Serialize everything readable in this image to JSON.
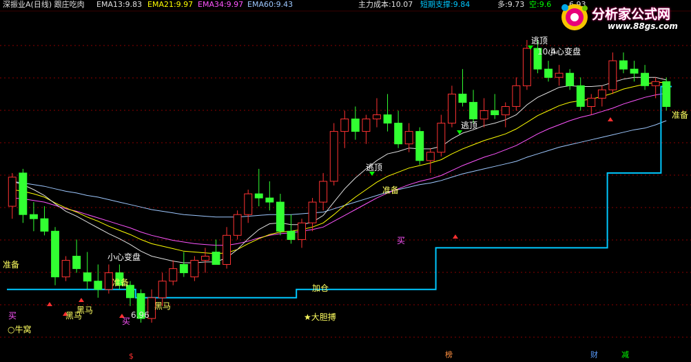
{
  "header": {
    "symbol": "深振业A",
    "period": "(日线)",
    "indicator": "跟庄吃肉",
    "ema13": {
      "label": "EMA13:",
      "value": "9.83",
      "color": "#e0e0e0"
    },
    "ema21": {
      "label": "EMA21:",
      "value": "9.97",
      "color": "#ffff00"
    },
    "ema34": {
      "label": "EMA34:",
      "value": "9.97",
      "color": "#ff55ff"
    },
    "ema60": {
      "label": "EMA60:",
      "value": "9.43",
      "color": "#9ec8ff"
    },
    "main_cost": {
      "label": "主力成本:",
      "value": "10.07",
      "color": "#e0e0e0"
    },
    "support": {
      "label": "短期支撑:",
      "value": "9.84",
      "color": "#00c8ff"
    },
    "long": {
      "label": "多:",
      "value": "9.73",
      "color": "#e0e0e0"
    },
    "short": {
      "label": "空:",
      "value": "9.6",
      "color": "#00ff00"
    },
    "trail": "6.93"
  },
  "logo": {
    "name": "分析家公式网",
    "url": "www.88gs.com"
  },
  "annotations": [
    {
      "text": "准备",
      "color": "#ffff60"
    },
    {
      "text": "买",
      "color": "#ff55ff"
    },
    {
      "text": "○牛窝",
      "color": "#ffff60"
    },
    {
      "text": "黑马",
      "color": "#ffff60"
    },
    {
      "text": "黑马",
      "color": "#ffff60"
    },
    {
      "text": "准备",
      "color": "#ffff60"
    },
    {
      "text": "小心变盘",
      "color": "#ffffff"
    },
    {
      "text": "买",
      "color": "#ff55ff"
    },
    {
      "text": "6.96",
      "color": "#e0e0e0"
    },
    {
      "text": "黑马",
      "color": "#ffff60"
    },
    {
      "text": "加仓",
      "color": "#ffff60"
    },
    {
      "text": "★大胆搏",
      "color": "#ffff60"
    },
    {
      "text": "逃顶",
      "color": "#ffffff"
    },
    {
      "text": "准备",
      "color": "#ffff60"
    },
    {
      "text": "买",
      "color": "#ff55ff"
    },
    {
      "text": "逃顶",
      "color": "#ffffff"
    },
    {
      "text": "逃顶",
      "color": "#ffffff"
    },
    {
      "text": "10.4",
      "color": "#e0e0e0"
    },
    {
      "text": "小心变盘",
      "color": "#ffffff"
    },
    {
      "text": "准备",
      "color": "#ffff60"
    }
  ],
  "markers": [
    {
      "text": "$",
      "color": "#ff3030"
    },
    {
      "text": "榜",
      "color": "#ff9040"
    },
    {
      "text": "财",
      "color": "#5a9cff"
    },
    {
      "text": "减",
      "color": "#00ff00"
    }
  ],
  "colors": {
    "up": "#ff3232",
    "down": "#32ff32",
    "ema13": "#e0e0e0",
    "ema21": "#ffff00",
    "ema34": "#ff55ff",
    "ema60": "#9ec8ff",
    "support": "#00c8ff",
    "grid": "#8b0000"
  },
  "chart_data": {
    "type": "candlestick",
    "y_range": [
      6.9,
      10.4
    ],
    "candles": [
      [
        8.4,
        8.8,
        8.25,
        8.75
      ],
      [
        8.8,
        8.85,
        8.2,
        8.3
      ],
      [
        8.3,
        8.45,
        8.1,
        8.25
      ],
      [
        8.25,
        8.4,
        8.05,
        8.1
      ],
      [
        8.1,
        8.15,
        7.45,
        7.55
      ],
      [
        7.55,
        7.8,
        7.5,
        7.75
      ],
      [
        7.8,
        8.0,
        7.6,
        7.65
      ],
      [
        7.6,
        7.85,
        7.4,
        7.5
      ],
      [
        7.5,
        7.7,
        7.3,
        7.4
      ],
      [
        7.4,
        7.7,
        7.35,
        7.6
      ],
      [
        7.6,
        7.7,
        7.4,
        7.45
      ],
      [
        7.45,
        7.5,
        7.2,
        7.3
      ],
      [
        7.35,
        7.4,
        7.0,
        7.05
      ],
      [
        7.05,
        7.4,
        7.0,
        7.3
      ],
      [
        7.3,
        7.6,
        7.2,
        7.5
      ],
      [
        7.5,
        7.75,
        7.45,
        7.65
      ],
      [
        7.7,
        7.85,
        7.55,
        7.6
      ],
      [
        7.55,
        7.8,
        7.5,
        7.75
      ],
      [
        7.75,
        7.9,
        7.6,
        7.8
      ],
      [
        7.85,
        8.0,
        7.7,
        7.7
      ],
      [
        7.7,
        8.15,
        7.65,
        8.05
      ],
      [
        8.05,
        8.35,
        8.0,
        8.3
      ],
      [
        8.3,
        8.6,
        8.2,
        8.55
      ],
      [
        8.55,
        8.85,
        8.4,
        8.5
      ],
      [
        8.5,
        8.7,
        8.35,
        8.45
      ],
      [
        8.45,
        8.55,
        8.05,
        8.1
      ],
      [
        8.1,
        8.3,
        7.95,
        8.0
      ],
      [
        8.0,
        8.25,
        7.9,
        8.2
      ],
      [
        8.2,
        8.5,
        8.1,
        8.45
      ],
      [
        8.45,
        8.8,
        8.35,
        8.7
      ],
      [
        8.7,
        9.4,
        8.65,
        9.3
      ],
      [
        9.3,
        9.55,
        9.1,
        9.45
      ],
      [
        9.45,
        9.6,
        9.2,
        9.3
      ],
      [
        9.3,
        9.5,
        9.15,
        9.45
      ],
      [
        9.45,
        9.7,
        9.35,
        9.5
      ],
      [
        9.5,
        9.75,
        9.3,
        9.4
      ],
      [
        9.4,
        9.55,
        9.1,
        9.15
      ],
      [
        9.15,
        9.4,
        9.05,
        9.3
      ],
      [
        9.3,
        9.35,
        8.9,
        8.95
      ],
      [
        8.95,
        9.1,
        8.8,
        9.05
      ],
      [
        9.05,
        9.5,
        9.0,
        9.4
      ],
      [
        9.4,
        9.85,
        9.35,
        9.75
      ],
      [
        9.75,
        10.05,
        9.6,
        9.65
      ],
      [
        9.65,
        9.8,
        9.4,
        9.45
      ],
      [
        9.45,
        9.7,
        9.35,
        9.55
      ],
      [
        9.55,
        9.75,
        9.45,
        9.5
      ],
      [
        9.5,
        9.65,
        9.35,
        9.6
      ],
      [
        9.6,
        9.95,
        9.55,
        9.85
      ],
      [
        9.85,
        10.4,
        9.8,
        10.3
      ],
      [
        10.3,
        10.4,
        10.0,
        10.05
      ],
      [
        10.05,
        10.15,
        9.9,
        9.95
      ],
      [
        9.95,
        10.1,
        9.85,
        10.0
      ],
      [
        10.0,
        10.05,
        9.8,
        9.85
      ],
      [
        9.85,
        9.95,
        9.55,
        9.6
      ],
      [
        9.6,
        9.75,
        9.5,
        9.7
      ],
      [
        9.7,
        9.85,
        9.6,
        9.8
      ],
      [
        9.8,
        10.25,
        9.75,
        10.15
      ],
      [
        10.15,
        10.25,
        10.0,
        10.05
      ],
      [
        10.05,
        10.15,
        9.9,
        10.0
      ],
      [
        10.0,
        10.1,
        9.8,
        9.85
      ],
      [
        9.85,
        9.95,
        9.7,
        9.9
      ],
      [
        9.9,
        9.95,
        9.55,
        9.6
      ]
    ],
    "ema13": [
      8.7,
      8.66,
      8.6,
      8.53,
      8.43,
      8.34,
      8.28,
      8.21,
      8.14,
      8.07,
      8.01,
      7.94,
      7.86,
      7.8,
      7.77,
      7.74,
      7.72,
      7.72,
      7.73,
      7.73,
      7.78,
      7.88,
      8.01,
      8.12,
      8.19,
      8.2,
      8.18,
      8.18,
      8.21,
      8.29,
      8.45,
      8.61,
      8.74,
      8.85,
      8.95,
      9.03,
      9.06,
      9.1,
      9.09,
      9.09,
      9.12,
      9.21,
      9.28,
      9.32,
      9.37,
      9.4,
      9.44,
      9.5,
      9.62,
      9.71,
      9.77,
      9.83,
      9.85,
      9.84,
      9.84,
      9.85,
      9.89,
      9.93,
      9.95,
      9.95,
      9.95,
      9.92
    ],
    "ema21": [
      8.6,
      8.58,
      8.55,
      8.51,
      8.44,
      8.38,
      8.33,
      8.27,
      8.22,
      8.16,
      8.11,
      8.06,
      8.0,
      7.95,
      7.92,
      7.89,
      7.86,
      7.85,
      7.84,
      7.83,
      7.84,
      7.88,
      7.95,
      8.01,
      8.06,
      8.09,
      8.1,
      8.12,
      8.15,
      8.2,
      8.3,
      8.41,
      8.51,
      8.6,
      8.69,
      8.76,
      8.81,
      8.86,
      8.89,
      8.92,
      8.96,
      9.03,
      9.09,
      9.14,
      9.19,
      9.23,
      9.27,
      9.33,
      9.41,
      9.49,
      9.55,
      9.61,
      9.65,
      9.67,
      9.69,
      9.72,
      9.76,
      9.81,
      9.84,
      9.87,
      9.89,
      9.89
    ],
    "ema34": [
      8.5,
      8.49,
      8.47,
      8.45,
      8.41,
      8.37,
      8.34,
      8.3,
      8.26,
      8.22,
      8.18,
      8.14,
      8.09,
      8.05,
      8.02,
      7.99,
      7.97,
      7.95,
      7.94,
      7.93,
      7.93,
      7.95,
      7.98,
      8.02,
      8.05,
      8.07,
      8.08,
      8.1,
      8.12,
      8.15,
      8.22,
      8.29,
      8.36,
      8.43,
      8.5,
      8.56,
      8.61,
      8.66,
      8.7,
      8.73,
      8.77,
      8.83,
      8.89,
      8.94,
      8.99,
      9.03,
      9.08,
      9.13,
      9.2,
      9.27,
      9.33,
      9.38,
      9.43,
      9.47,
      9.5,
      9.54,
      9.58,
      9.63,
      9.67,
      9.71,
      9.74,
      9.76
    ],
    "ema60": [
      8.7,
      8.68,
      8.66,
      8.64,
      8.61,
      8.58,
      8.56,
      8.53,
      8.51,
      8.48,
      8.45,
      8.42,
      8.39,
      8.36,
      8.34,
      8.32,
      8.3,
      8.29,
      8.28,
      8.27,
      8.27,
      8.27,
      8.28,
      8.29,
      8.3,
      8.3,
      8.3,
      8.31,
      8.32,
      8.33,
      8.37,
      8.41,
      8.45,
      8.49,
      8.53,
      8.57,
      8.6,
      8.63,
      8.66,
      8.68,
      8.71,
      8.75,
      8.79,
      8.82,
      8.85,
      8.88,
      8.91,
      8.94,
      8.99,
      9.03,
      9.07,
      9.11,
      9.14,
      9.17,
      9.2,
      9.23,
      9.26,
      9.29,
      9.32,
      9.34,
      9.38,
      9.43
    ],
    "support": [
      7.4,
      7.4,
      7.4,
      7.4,
      7.4,
      7.4,
      7.4,
      7.4,
      7.4,
      7.4,
      7.4,
      7.4,
      7.3,
      7.3,
      7.3,
      7.3,
      7.3,
      7.3,
      7.3,
      7.3,
      7.3,
      7.3,
      7.3,
      7.3,
      7.3,
      7.3,
      7.3,
      7.4,
      7.4,
      7.4,
      7.4,
      7.4,
      7.4,
      7.4,
      7.4,
      7.4,
      7.4,
      7.4,
      7.4,
      7.4,
      7.9,
      7.9,
      7.9,
      7.9,
      7.9,
      7.9,
      7.9,
      7.9,
      7.9,
      7.9,
      7.9,
      7.9,
      7.9,
      7.9,
      7.9,
      7.9,
      8.8,
      8.8,
      8.8,
      8.8,
      8.8,
      9.84
    ]
  }
}
